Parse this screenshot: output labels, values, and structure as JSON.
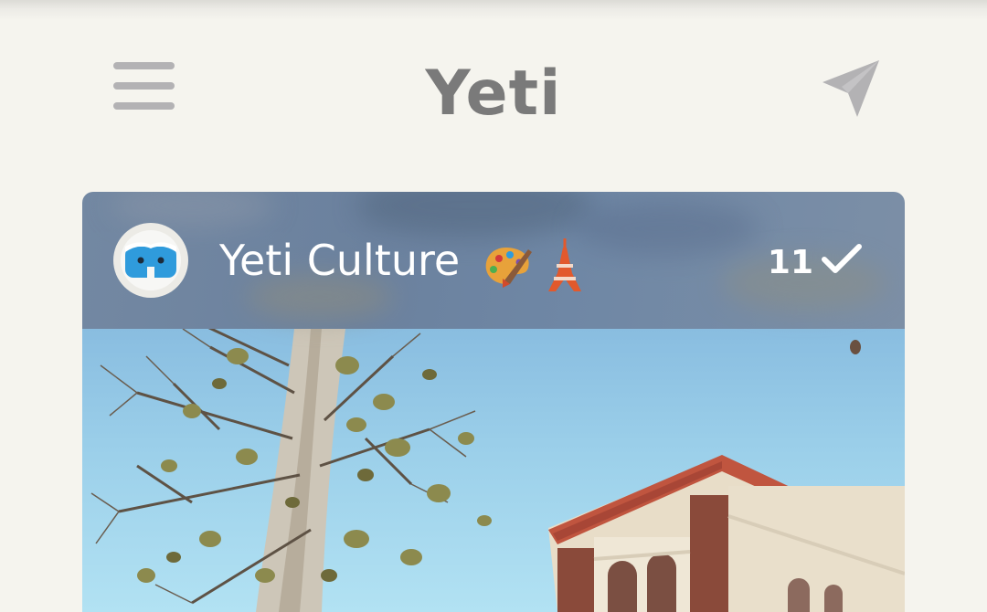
{
  "app": {
    "title": "Yeti",
    "menu_icon": "hamburger-menu-icon",
    "send_icon": "paper-plane-icon"
  },
  "channel": {
    "name": "Yeti Culture",
    "emoji": [
      "🎨",
      "🗼"
    ],
    "count": "11",
    "check_icon": "checkmark-icon",
    "avatar_icon": "yeti-avatar-icon"
  },
  "colors": {
    "background": "#f5f4ee",
    "icon_gray": "#b3b2b4",
    "title_gray": "#7a7a7a",
    "header_overlay": "#6f86a3",
    "avatar_blue": "#2f9bdc",
    "sky": "#9cd0ea",
    "brick": "#8a4a3a",
    "roof": "#c0553f"
  }
}
